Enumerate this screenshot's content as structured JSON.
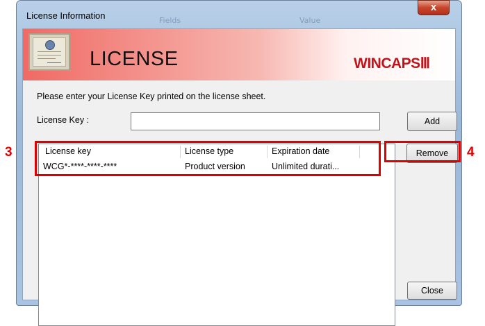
{
  "window": {
    "title": "License Information",
    "close_glyph": "x",
    "background_ghost_text": [
      "Fields",
      "Value"
    ]
  },
  "banner": {
    "heading": "LICENSE",
    "brand": "WINCAPSⅢ",
    "certificate_icon": "license-certificate-icon"
  },
  "instruction": "Please enter your License Key printed on the license sheet.",
  "license_key": {
    "label": "License Key :",
    "value": ""
  },
  "buttons": {
    "add": "Add",
    "remove": "Remove",
    "close": "Close"
  },
  "table": {
    "columns": [
      "License key",
      "License type",
      "Expiration date"
    ],
    "rows": [
      [
        "WCG*-****-****-****",
        "Product version",
        "Unlimited durati..."
      ]
    ]
  },
  "annotations": {
    "left_number": "3",
    "right_number": "4",
    "highlight_color": "#e00000"
  },
  "colors": {
    "banner_start": "#f06a64",
    "brand": "#c0141a",
    "close_button": "#c7452c"
  }
}
